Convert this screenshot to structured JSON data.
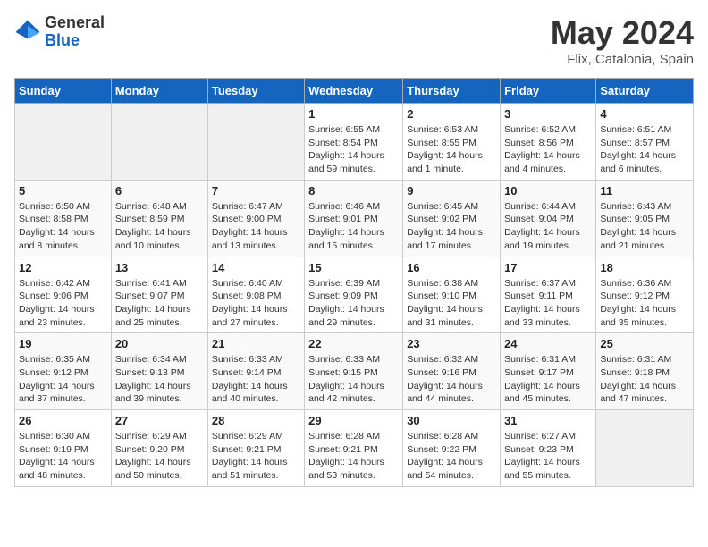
{
  "header": {
    "logo_general": "General",
    "logo_blue": "Blue",
    "title": "May 2024",
    "location": "Flix, Catalonia, Spain"
  },
  "days_of_week": [
    "Sunday",
    "Monday",
    "Tuesday",
    "Wednesday",
    "Thursday",
    "Friday",
    "Saturday"
  ],
  "weeks": [
    [
      {
        "day": "",
        "info": ""
      },
      {
        "day": "",
        "info": ""
      },
      {
        "day": "",
        "info": ""
      },
      {
        "day": "1",
        "info": "Sunrise: 6:55 AM\nSunset: 8:54 PM\nDaylight: 14 hours\nand 59 minutes."
      },
      {
        "day": "2",
        "info": "Sunrise: 6:53 AM\nSunset: 8:55 PM\nDaylight: 14 hours\nand 1 minute."
      },
      {
        "day": "3",
        "info": "Sunrise: 6:52 AM\nSunset: 8:56 PM\nDaylight: 14 hours\nand 4 minutes."
      },
      {
        "day": "4",
        "info": "Sunrise: 6:51 AM\nSunset: 8:57 PM\nDaylight: 14 hours\nand 6 minutes."
      }
    ],
    [
      {
        "day": "5",
        "info": "Sunrise: 6:50 AM\nSunset: 8:58 PM\nDaylight: 14 hours\nand 8 minutes."
      },
      {
        "day": "6",
        "info": "Sunrise: 6:48 AM\nSunset: 8:59 PM\nDaylight: 14 hours\nand 10 minutes."
      },
      {
        "day": "7",
        "info": "Sunrise: 6:47 AM\nSunset: 9:00 PM\nDaylight: 14 hours\nand 13 minutes."
      },
      {
        "day": "8",
        "info": "Sunrise: 6:46 AM\nSunset: 9:01 PM\nDaylight: 14 hours\nand 15 minutes."
      },
      {
        "day": "9",
        "info": "Sunrise: 6:45 AM\nSunset: 9:02 PM\nDaylight: 14 hours\nand 17 minutes."
      },
      {
        "day": "10",
        "info": "Sunrise: 6:44 AM\nSunset: 9:04 PM\nDaylight: 14 hours\nand 19 minutes."
      },
      {
        "day": "11",
        "info": "Sunrise: 6:43 AM\nSunset: 9:05 PM\nDaylight: 14 hours\nand 21 minutes."
      }
    ],
    [
      {
        "day": "12",
        "info": "Sunrise: 6:42 AM\nSunset: 9:06 PM\nDaylight: 14 hours\nand 23 minutes."
      },
      {
        "day": "13",
        "info": "Sunrise: 6:41 AM\nSunset: 9:07 PM\nDaylight: 14 hours\nand 25 minutes."
      },
      {
        "day": "14",
        "info": "Sunrise: 6:40 AM\nSunset: 9:08 PM\nDaylight: 14 hours\nand 27 minutes."
      },
      {
        "day": "15",
        "info": "Sunrise: 6:39 AM\nSunset: 9:09 PM\nDaylight: 14 hours\nand 29 minutes."
      },
      {
        "day": "16",
        "info": "Sunrise: 6:38 AM\nSunset: 9:10 PM\nDaylight: 14 hours\nand 31 minutes."
      },
      {
        "day": "17",
        "info": "Sunrise: 6:37 AM\nSunset: 9:11 PM\nDaylight: 14 hours\nand 33 minutes."
      },
      {
        "day": "18",
        "info": "Sunrise: 6:36 AM\nSunset: 9:12 PM\nDaylight: 14 hours\nand 35 minutes."
      }
    ],
    [
      {
        "day": "19",
        "info": "Sunrise: 6:35 AM\nSunset: 9:12 PM\nDaylight: 14 hours\nand 37 minutes."
      },
      {
        "day": "20",
        "info": "Sunrise: 6:34 AM\nSunset: 9:13 PM\nDaylight: 14 hours\nand 39 minutes."
      },
      {
        "day": "21",
        "info": "Sunrise: 6:33 AM\nSunset: 9:14 PM\nDaylight: 14 hours\nand 40 minutes."
      },
      {
        "day": "22",
        "info": "Sunrise: 6:33 AM\nSunset: 9:15 PM\nDaylight: 14 hours\nand 42 minutes."
      },
      {
        "day": "23",
        "info": "Sunrise: 6:32 AM\nSunset: 9:16 PM\nDaylight: 14 hours\nand 44 minutes."
      },
      {
        "day": "24",
        "info": "Sunrise: 6:31 AM\nSunset: 9:17 PM\nDaylight: 14 hours\nand 45 minutes."
      },
      {
        "day": "25",
        "info": "Sunrise: 6:31 AM\nSunset: 9:18 PM\nDaylight: 14 hours\nand 47 minutes."
      }
    ],
    [
      {
        "day": "26",
        "info": "Sunrise: 6:30 AM\nSunset: 9:19 PM\nDaylight: 14 hours\nand 48 minutes."
      },
      {
        "day": "27",
        "info": "Sunrise: 6:29 AM\nSunset: 9:20 PM\nDaylight: 14 hours\nand 50 minutes."
      },
      {
        "day": "28",
        "info": "Sunrise: 6:29 AM\nSunset: 9:21 PM\nDaylight: 14 hours\nand 51 minutes."
      },
      {
        "day": "29",
        "info": "Sunrise: 6:28 AM\nSunset: 9:21 PM\nDaylight: 14 hours\nand 53 minutes."
      },
      {
        "day": "30",
        "info": "Sunrise: 6:28 AM\nSunset: 9:22 PM\nDaylight: 14 hours\nand 54 minutes."
      },
      {
        "day": "31",
        "info": "Sunrise: 6:27 AM\nSunset: 9:23 PM\nDaylight: 14 hours\nand 55 minutes."
      },
      {
        "day": "",
        "info": ""
      }
    ]
  ]
}
